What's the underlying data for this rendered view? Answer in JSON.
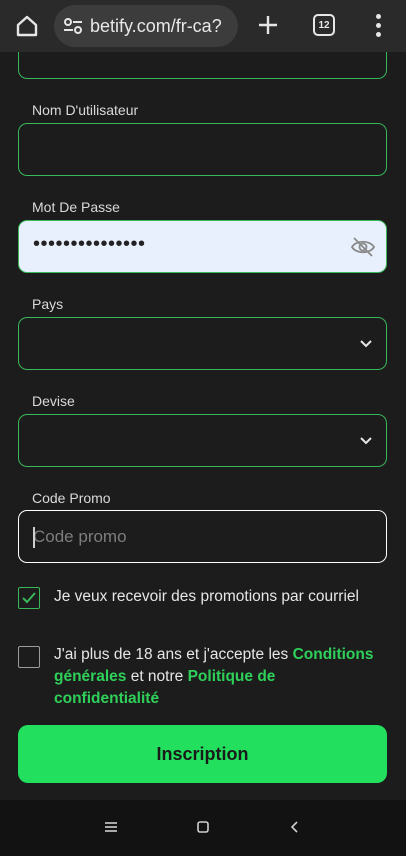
{
  "browser": {
    "url": "betify.com/fr-ca?",
    "tab_count": "12"
  },
  "form": {
    "username_label": "Nom D'utilisateur",
    "password_label": "Mot De Passe",
    "password_value": "•••••••••••••••",
    "country_label": "Pays",
    "currency_label": "Devise",
    "promo_label": "Code Promo",
    "promo_placeholder": "Code promo",
    "promotions_checkbox": {
      "checked": true,
      "text": "Je veux recevoir des promotions par courriel"
    },
    "terms_checkbox": {
      "checked": false,
      "text_before": "J'ai plus de 18 ans et j'accepte les ",
      "terms_link": "Conditions générales",
      "text_middle": " et notre ",
      "privacy_link": "Politique de confidentialité"
    },
    "submit_label": "Inscription"
  },
  "icons": {
    "home": "home-icon",
    "site_info": "tune-icon",
    "new_tab": "plus-icon",
    "menu": "more-vert-icon",
    "password_visibility": "eye-off-icon",
    "select": "chevron-down-icon",
    "nav_recents": "menu-lines-icon",
    "nav_home": "square-icon",
    "nav_back": "chevron-left-icon"
  },
  "colors": {
    "accent": "#22e05e",
    "field_border": "#38b85a",
    "link": "#2fd05a",
    "background": "#1c1c1c"
  }
}
